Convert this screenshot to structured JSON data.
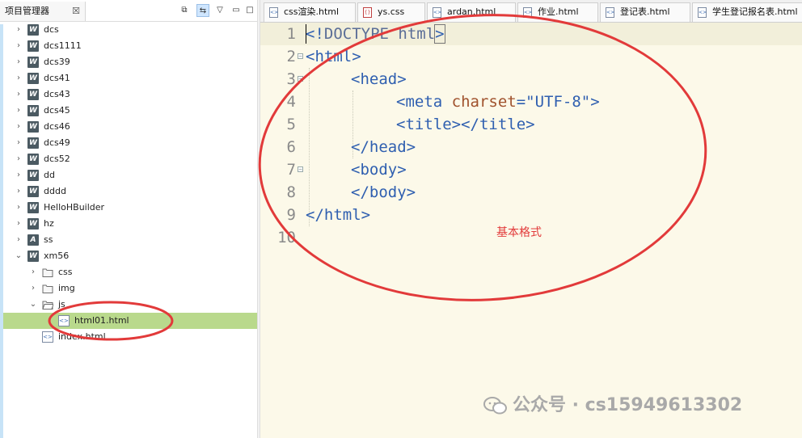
{
  "left_panel": {
    "tab_title": "项目管理器",
    "close_glyph": "☒",
    "tree": [
      {
        "label": "dcs",
        "kind": "project",
        "badge": "W",
        "expanded": false
      },
      {
        "label": "dcs1111",
        "kind": "project",
        "badge": "W",
        "expanded": false
      },
      {
        "label": "dcs39",
        "kind": "project",
        "badge": "W",
        "expanded": false
      },
      {
        "label": "dcs41",
        "kind": "project",
        "badge": "W",
        "expanded": false
      },
      {
        "label": "dcs43",
        "kind": "project",
        "badge": "W",
        "expanded": false
      },
      {
        "label": "dcs45",
        "kind": "project",
        "badge": "W",
        "expanded": false
      },
      {
        "label": "dcs46",
        "kind": "project",
        "badge": "W",
        "expanded": false
      },
      {
        "label": "dcs49",
        "kind": "project",
        "badge": "W",
        "expanded": false
      },
      {
        "label": "dcs52",
        "kind": "project",
        "badge": "W",
        "expanded": false
      },
      {
        "label": "dd",
        "kind": "project",
        "badge": "W",
        "expanded": false
      },
      {
        "label": "dddd",
        "kind": "project",
        "badge": "W",
        "expanded": false
      },
      {
        "label": "HelloHBuilder",
        "kind": "project",
        "badge": "W",
        "expanded": false
      },
      {
        "label": "hz",
        "kind": "project",
        "badge": "W",
        "expanded": false
      },
      {
        "label": "ss",
        "kind": "project",
        "badge": "A",
        "expanded": false
      },
      {
        "label": "xm56",
        "kind": "project",
        "badge": "W",
        "expanded": true
      },
      {
        "label": "css",
        "kind": "folder",
        "expanded": false
      },
      {
        "label": "img",
        "kind": "folder",
        "expanded": false
      },
      {
        "label": "js",
        "kind": "folder",
        "expanded": true
      },
      {
        "label": "html01.html",
        "kind": "file",
        "selected": true
      },
      {
        "label": "index.html",
        "kind": "file"
      }
    ]
  },
  "editor": {
    "tabs": [
      {
        "label": "css渲染.html",
        "icon": "html-file-icon"
      },
      {
        "label": "ys.css",
        "icon": "css-file-icon"
      },
      {
        "label": "ardan.html",
        "icon": "html-file-icon"
      },
      {
        "label": "作业.html",
        "icon": "html-file-icon"
      },
      {
        "label": "登记表.html",
        "icon": "html-file-icon"
      },
      {
        "label": "学生登记报名表.html",
        "icon": "html-file-icon"
      }
    ],
    "line_numbers": [
      "1",
      "2",
      "3",
      "4",
      "5",
      "6",
      "7",
      "8",
      "9",
      "10"
    ],
    "code": {
      "l1a": "<!",
      "l1b": "DOCTYPE",
      "l1c": " html",
      "l2": "<html>",
      "l3": "<head>",
      "l4a": "<meta ",
      "l4b": "charset",
      "l4c": "=",
      "l4d": "\"UTF-8\"",
      "l4e": ">",
      "l5": "<title></title>",
      "l6": "</head>",
      "l7": "<body>",
      "l8": "</body>",
      "l9": "</html>"
    },
    "annotation": "基本格式",
    "gt": ">"
  },
  "watermark": "公众号 · cs15949613302",
  "colors": {
    "selection": "#b9d98c",
    "editor_bg": "#fcf9e9",
    "annotation_red": "#e23a3a"
  }
}
